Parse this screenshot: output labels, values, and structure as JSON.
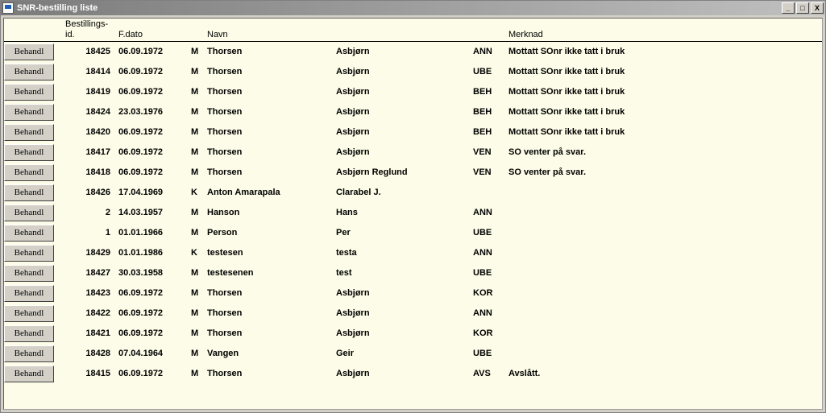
{
  "window": {
    "title": "SNR-bestilling liste"
  },
  "winbtns": {
    "min": "_",
    "max": "□",
    "close": "X"
  },
  "headers": {
    "bestillings": "Bestillings-",
    "id": "id.",
    "fdato": "F.dato",
    "navn": "Navn",
    "merknad": "Merknad"
  },
  "button_label": "Behandl",
  "rows": [
    {
      "id": "18425",
      "dato": "06.09.1972",
      "kj": "M",
      "etter": "Thorsen",
      "for": "Asbjørn",
      "stat": "ANN",
      "merk": "Mottatt SOnr ikke tatt i bruk"
    },
    {
      "id": "18414",
      "dato": "06.09.1972",
      "kj": "M",
      "etter": "Thorsen",
      "for": "Asbjørn",
      "stat": "UBE",
      "merk": "Mottatt SOnr ikke tatt i bruk"
    },
    {
      "id": "18419",
      "dato": "06.09.1972",
      "kj": "M",
      "etter": "Thorsen",
      "for": "Asbjørn",
      "stat": "BEH",
      "merk": "Mottatt SOnr ikke tatt i bruk"
    },
    {
      "id": "18424",
      "dato": "23.03.1976",
      "kj": "M",
      "etter": "Thorsen",
      "for": "Asbjørn",
      "stat": "BEH",
      "merk": "Mottatt SOnr ikke tatt i bruk"
    },
    {
      "id": "18420",
      "dato": "06.09.1972",
      "kj": "M",
      "etter": "Thorsen",
      "for": "Asbjørn",
      "stat": "BEH",
      "merk": "Mottatt SOnr ikke tatt i bruk"
    },
    {
      "id": "18417",
      "dato": "06.09.1972",
      "kj": "M",
      "etter": "Thorsen",
      "for": "Asbjørn",
      "stat": "VEN",
      "merk": "SO venter på svar."
    },
    {
      "id": "18418",
      "dato": "06.09.1972",
      "kj": "M",
      "etter": "Thorsen",
      "for": "Asbjørn Reglund",
      "stat": "VEN",
      "merk": "SO venter på svar."
    },
    {
      "id": "18426",
      "dato": "17.04.1969",
      "kj": "K",
      "etter": "Anton Amarapala",
      "for": "Clarabel J.",
      "stat": "",
      "merk": ""
    },
    {
      "id": "2",
      "dato": "14.03.1957",
      "kj": "M",
      "etter": "Hanson",
      "for": "Hans",
      "stat": "ANN",
      "merk": ""
    },
    {
      "id": "1",
      "dato": "01.01.1966",
      "kj": "M",
      "etter": "Person",
      "for": "Per",
      "stat": "UBE",
      "merk": ""
    },
    {
      "id": "18429",
      "dato": "01.01.1986",
      "kj": "K",
      "etter": "testesen",
      "for": "testa",
      "stat": "ANN",
      "merk": ""
    },
    {
      "id": "18427",
      "dato": "30.03.1958",
      "kj": "M",
      "etter": "testesenen",
      "for": "test",
      "stat": "UBE",
      "merk": ""
    },
    {
      "id": "18423",
      "dato": "06.09.1972",
      "kj": "M",
      "etter": "Thorsen",
      "for": "Asbjørn",
      "stat": "KOR",
      "merk": ""
    },
    {
      "id": "18422",
      "dato": "06.09.1972",
      "kj": "M",
      "etter": "Thorsen",
      "for": "Asbjørn",
      "stat": "ANN",
      "merk": ""
    },
    {
      "id": "18421",
      "dato": "06.09.1972",
      "kj": "M",
      "etter": "Thorsen",
      "for": "Asbjørn",
      "stat": "KOR",
      "merk": ""
    },
    {
      "id": "18428",
      "dato": "07.04.1964",
      "kj": "M",
      "etter": "Vangen",
      "for": "Geir",
      "stat": "UBE",
      "merk": ""
    },
    {
      "id": "18415",
      "dato": "06.09.1972",
      "kj": "M",
      "etter": "Thorsen",
      "for": "Asbjørn",
      "stat": "AVS",
      "merk": "Avslått."
    }
  ]
}
